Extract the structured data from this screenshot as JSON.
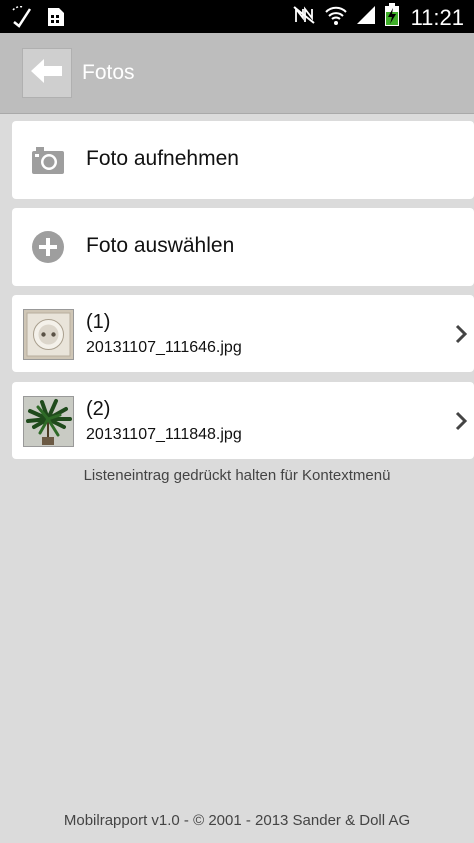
{
  "status_bar": {
    "time": "11:21",
    "left_icons": [
      "wifi-tethering-icon",
      "sim-storage-icon"
    ],
    "right_icons": [
      "nfc-muted-icon",
      "wifi-icon",
      "signal-icon",
      "battery-charging-icon"
    ]
  },
  "action_bar": {
    "title": "Fotos",
    "back_icon": "arrow-left-icon"
  },
  "actions": [
    {
      "label": "Foto aufnehmen",
      "icon": "camera-icon"
    },
    {
      "label": "Foto auswählen",
      "icon": "plus-circle-icon"
    }
  ],
  "photos": [
    {
      "index": "(1)",
      "filename": "20131107_111646.jpg",
      "thumbnail": "power-socket-photo"
    },
    {
      "index": "(2)",
      "filename": "20131107_111848.jpg",
      "thumbnail": "plant-photo"
    }
  ],
  "hint": "Listeneintrag gedrückt halten für Kontextmenü",
  "footer": "Mobilrapport v1.0 - © 2001 - 2013 Sander & Doll AG",
  "colors": {
    "background": "#dbdbdb",
    "action_bar": "#bdbdbd",
    "card": "#ffffff",
    "status_bar": "#000000",
    "icon_gray": "#9e9e9e"
  }
}
